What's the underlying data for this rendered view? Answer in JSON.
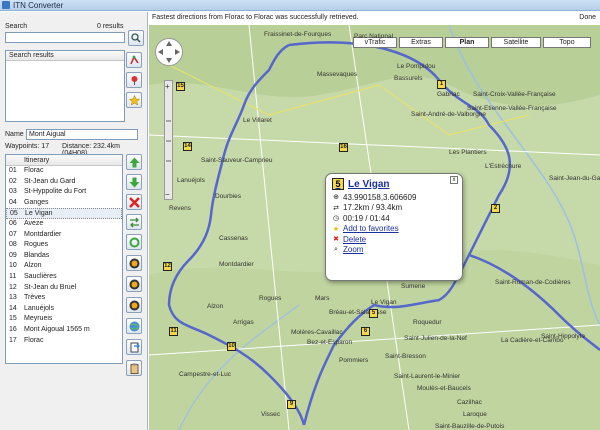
{
  "app": {
    "title": "ITN Converter"
  },
  "status": {
    "message": "Fastest directions from Florac to Florac was successfully retrieved.",
    "done": "Done"
  },
  "search": {
    "label": "Search",
    "results_count": "0 results",
    "results_header": "Search results"
  },
  "route": {
    "name_label": "Name",
    "name_value": "Mont Aigual",
    "waypoints_label": "Waypoints: 17",
    "distance_label": "Distance: 232.4km (04H08)"
  },
  "itinerary": {
    "header": "Itinerary",
    "items": [
      {
        "num": "01",
        "name": "Florac"
      },
      {
        "num": "02",
        "name": "St-Jean du Gard"
      },
      {
        "num": "03",
        "name": "St-Hyppolite du Fort"
      },
      {
        "num": "04",
        "name": "Ganges"
      },
      {
        "num": "05",
        "name": "Le Vigan"
      },
      {
        "num": "06",
        "name": "Aveze"
      },
      {
        "num": "07",
        "name": "Montdardier"
      },
      {
        "num": "08",
        "name": "Rogues"
      },
      {
        "num": "09",
        "name": "Blandas"
      },
      {
        "num": "10",
        "name": "Alzon"
      },
      {
        "num": "11",
        "name": "Sauclières"
      },
      {
        "num": "12",
        "name": "St-Jean du Bruel"
      },
      {
        "num": "13",
        "name": "Trèves"
      },
      {
        "num": "14",
        "name": "Lanuéjols"
      },
      {
        "num": "15",
        "name": "Meyrueis"
      },
      {
        "num": "16",
        "name": "Mont Aigoual 1565 m"
      },
      {
        "num": "17",
        "name": "Florac"
      }
    ]
  },
  "map_tabs": [
    "vTrafic",
    "Extras",
    "Plan",
    "Satellite",
    "Topo"
  ],
  "popup": {
    "number": "5",
    "title": "Le Vigan",
    "coords": "43.990158,3.606609",
    "distance": "17.2km / 93.4km",
    "time": "00:19 / 01:44",
    "add_fav": "Add to favorites",
    "delete": "Delete",
    "zoom": "Zoom"
  },
  "map_labels": [
    {
      "text": "Fraissinet-de-Fourques"
    },
    {
      "text": "Parc National"
    },
    {
      "text": "Le Pompidou"
    },
    {
      "text": "Gabriac"
    },
    {
      "text": "Saint-Croix-Vallée-Française"
    },
    {
      "text": "Bassurels"
    },
    {
      "text": "Saint-Etienne-Vallée-Française"
    },
    {
      "text": "Saint-André-de-Valborgne"
    },
    {
      "text": "Massevaques"
    },
    {
      "text": "Saint-Sauveur-Camprieu"
    },
    {
      "text": "Les Plantiers"
    },
    {
      "text": "L'Estréchure"
    },
    {
      "text": "Saint-Jean-du-Gard"
    },
    {
      "text": "Dourbies"
    },
    {
      "text": "Saint-Roman-de-Codières"
    },
    {
      "text": "Nant"
    },
    {
      "text": "Bréau-et-Salagosse"
    },
    {
      "text": "Le Vigan"
    },
    {
      "text": "Roquedur"
    },
    {
      "text": "Saint-Julien-de-la-Nef"
    },
    {
      "text": "Saint-Hippolyte"
    },
    {
      "text": "Alzon"
    },
    {
      "text": "Molères-Cavaillac"
    },
    {
      "text": "Bez-et-Esparon"
    },
    {
      "text": "Pommiers"
    },
    {
      "text": "Saint-Bresson"
    },
    {
      "text": "Campestre-et-Luc"
    },
    {
      "text": "Saint-Laurent-le-Minier"
    },
    {
      "text": "Moulès-et-Baucels"
    },
    {
      "text": "La Cadière-et-Cambo"
    },
    {
      "text": "Cazilhac"
    },
    {
      "text": "Laroque"
    },
    {
      "text": "Saint-Bauzille-de-Putois"
    },
    {
      "text": "Vissec"
    },
    {
      "text": "Arrigas"
    },
    {
      "text": "Montdardier"
    },
    {
      "text": "Mars"
    },
    {
      "text": "Rogues"
    },
    {
      "text": "Sumene"
    },
    {
      "text": "Le Villaret"
    },
    {
      "text": "Cassenas"
    },
    {
      "text": "Lanuéjols"
    },
    {
      "text": "Revens"
    }
  ],
  "colors": {
    "route": "#5566cc",
    "water": "#9cc0e6",
    "road": "#ffffff",
    "map_bg": "#c4d6a4"
  }
}
